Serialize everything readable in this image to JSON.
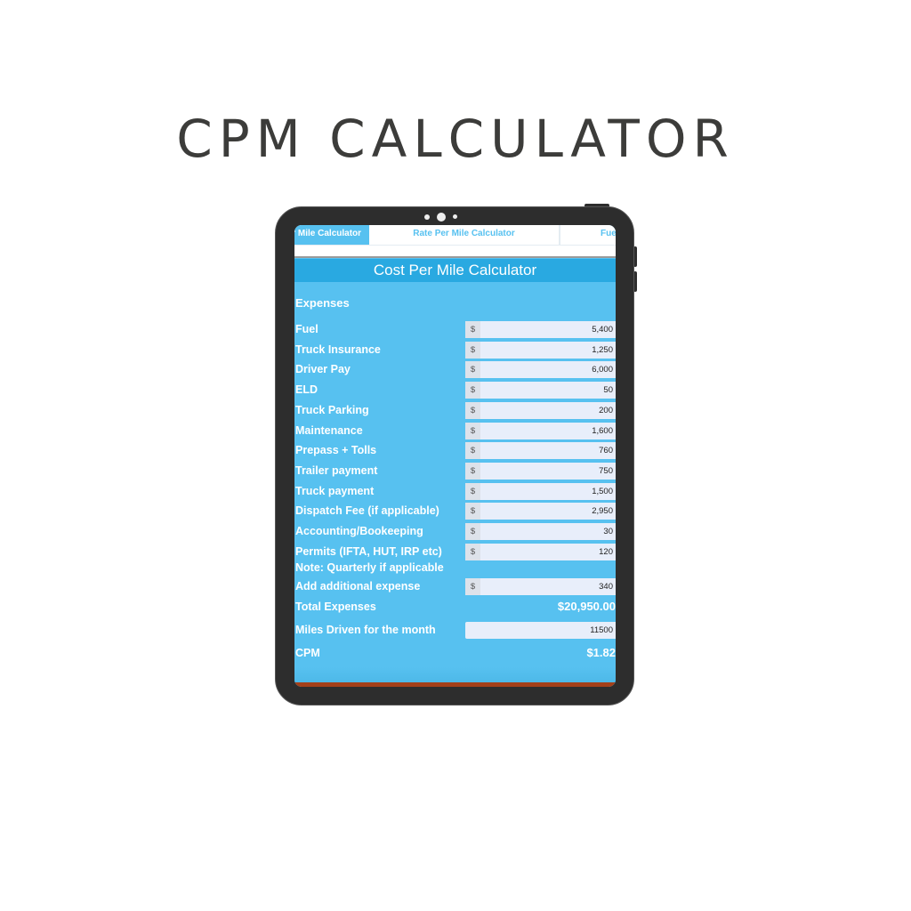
{
  "page_title": "CPM CALCULATOR",
  "tabs": [
    {
      "label": "Cost Per Mile Calculator"
    },
    {
      "label": "Rate Per Mile Calculator"
    },
    {
      "label": "Fuel"
    }
  ],
  "header": "Cost Per Mile Calculator",
  "section": "Expenses",
  "currency": "$",
  "expenses": [
    {
      "label": "Fuel",
      "value": "5,400"
    },
    {
      "label": "Truck Insurance",
      "value": "1,250"
    },
    {
      "label": "Driver Pay",
      "value": "6,000"
    },
    {
      "label": "ELD",
      "value": "50"
    },
    {
      "label": "Truck Parking",
      "value": "200"
    },
    {
      "label": "Maintenance",
      "value": "1,600"
    },
    {
      "label": "Prepass + Tolls",
      "value": "760"
    },
    {
      "label": "Trailer payment",
      "value": "750"
    },
    {
      "label": "Truck payment",
      "value": "1,500"
    },
    {
      "label": "Dispatch Fee (if applicable)",
      "value": "2,950"
    },
    {
      "label": "Accounting/Bookeeping",
      "value": "30"
    },
    {
      "label": "Permits (IFTA, HUT, IRP etc)",
      "value": "120"
    }
  ],
  "permits_note": "Note: Quarterly if applicable",
  "additional": {
    "label": "Add additional expense",
    "value": "340"
  },
  "total": {
    "label": "Total Expenses",
    "value": "$20,950.00"
  },
  "miles": {
    "label": "Miles Driven for the month",
    "value": "11500"
  },
  "cpm": {
    "label": "CPM",
    "value": "$1.82"
  },
  "colors": {
    "accent": "#57c1f0",
    "header": "#29a9e1",
    "bezel": "#2d2d2d"
  }
}
